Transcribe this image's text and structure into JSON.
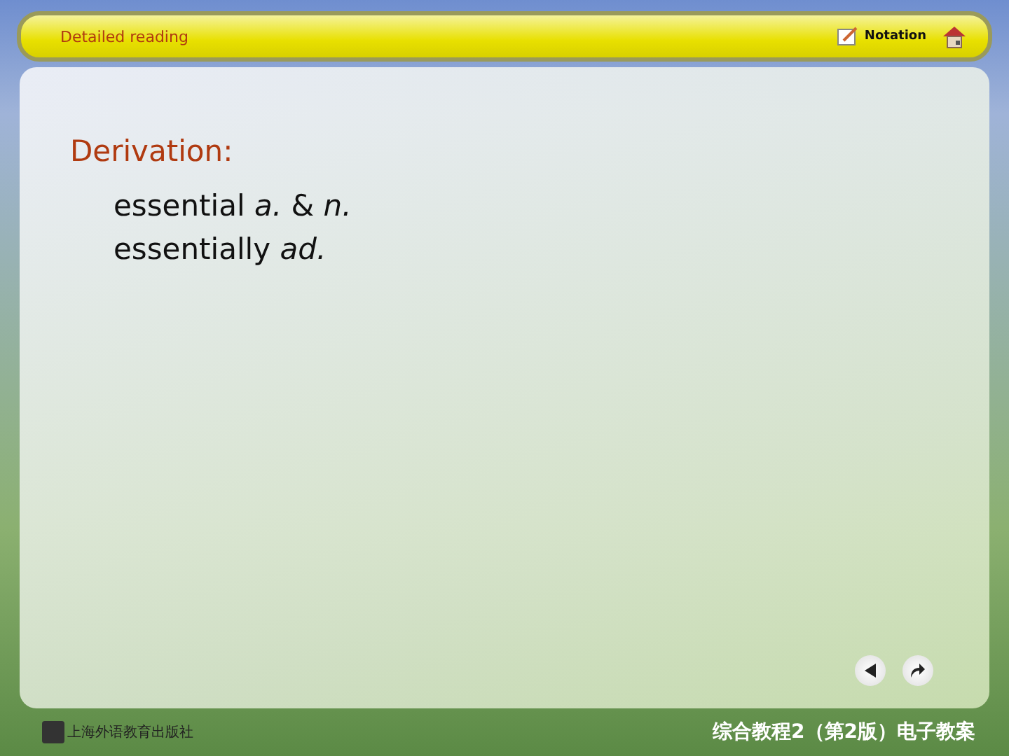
{
  "header": {
    "title": "Detailed reading",
    "notation": "Notation"
  },
  "content": {
    "heading": "Derivation:",
    "lines": [
      "essential *a.* & *n.*",
      "essentially *ad.*"
    ]
  },
  "footer": {
    "publisher": "上海外语教育出版社",
    "course": "综合教程2（第2版）电子教案"
  }
}
